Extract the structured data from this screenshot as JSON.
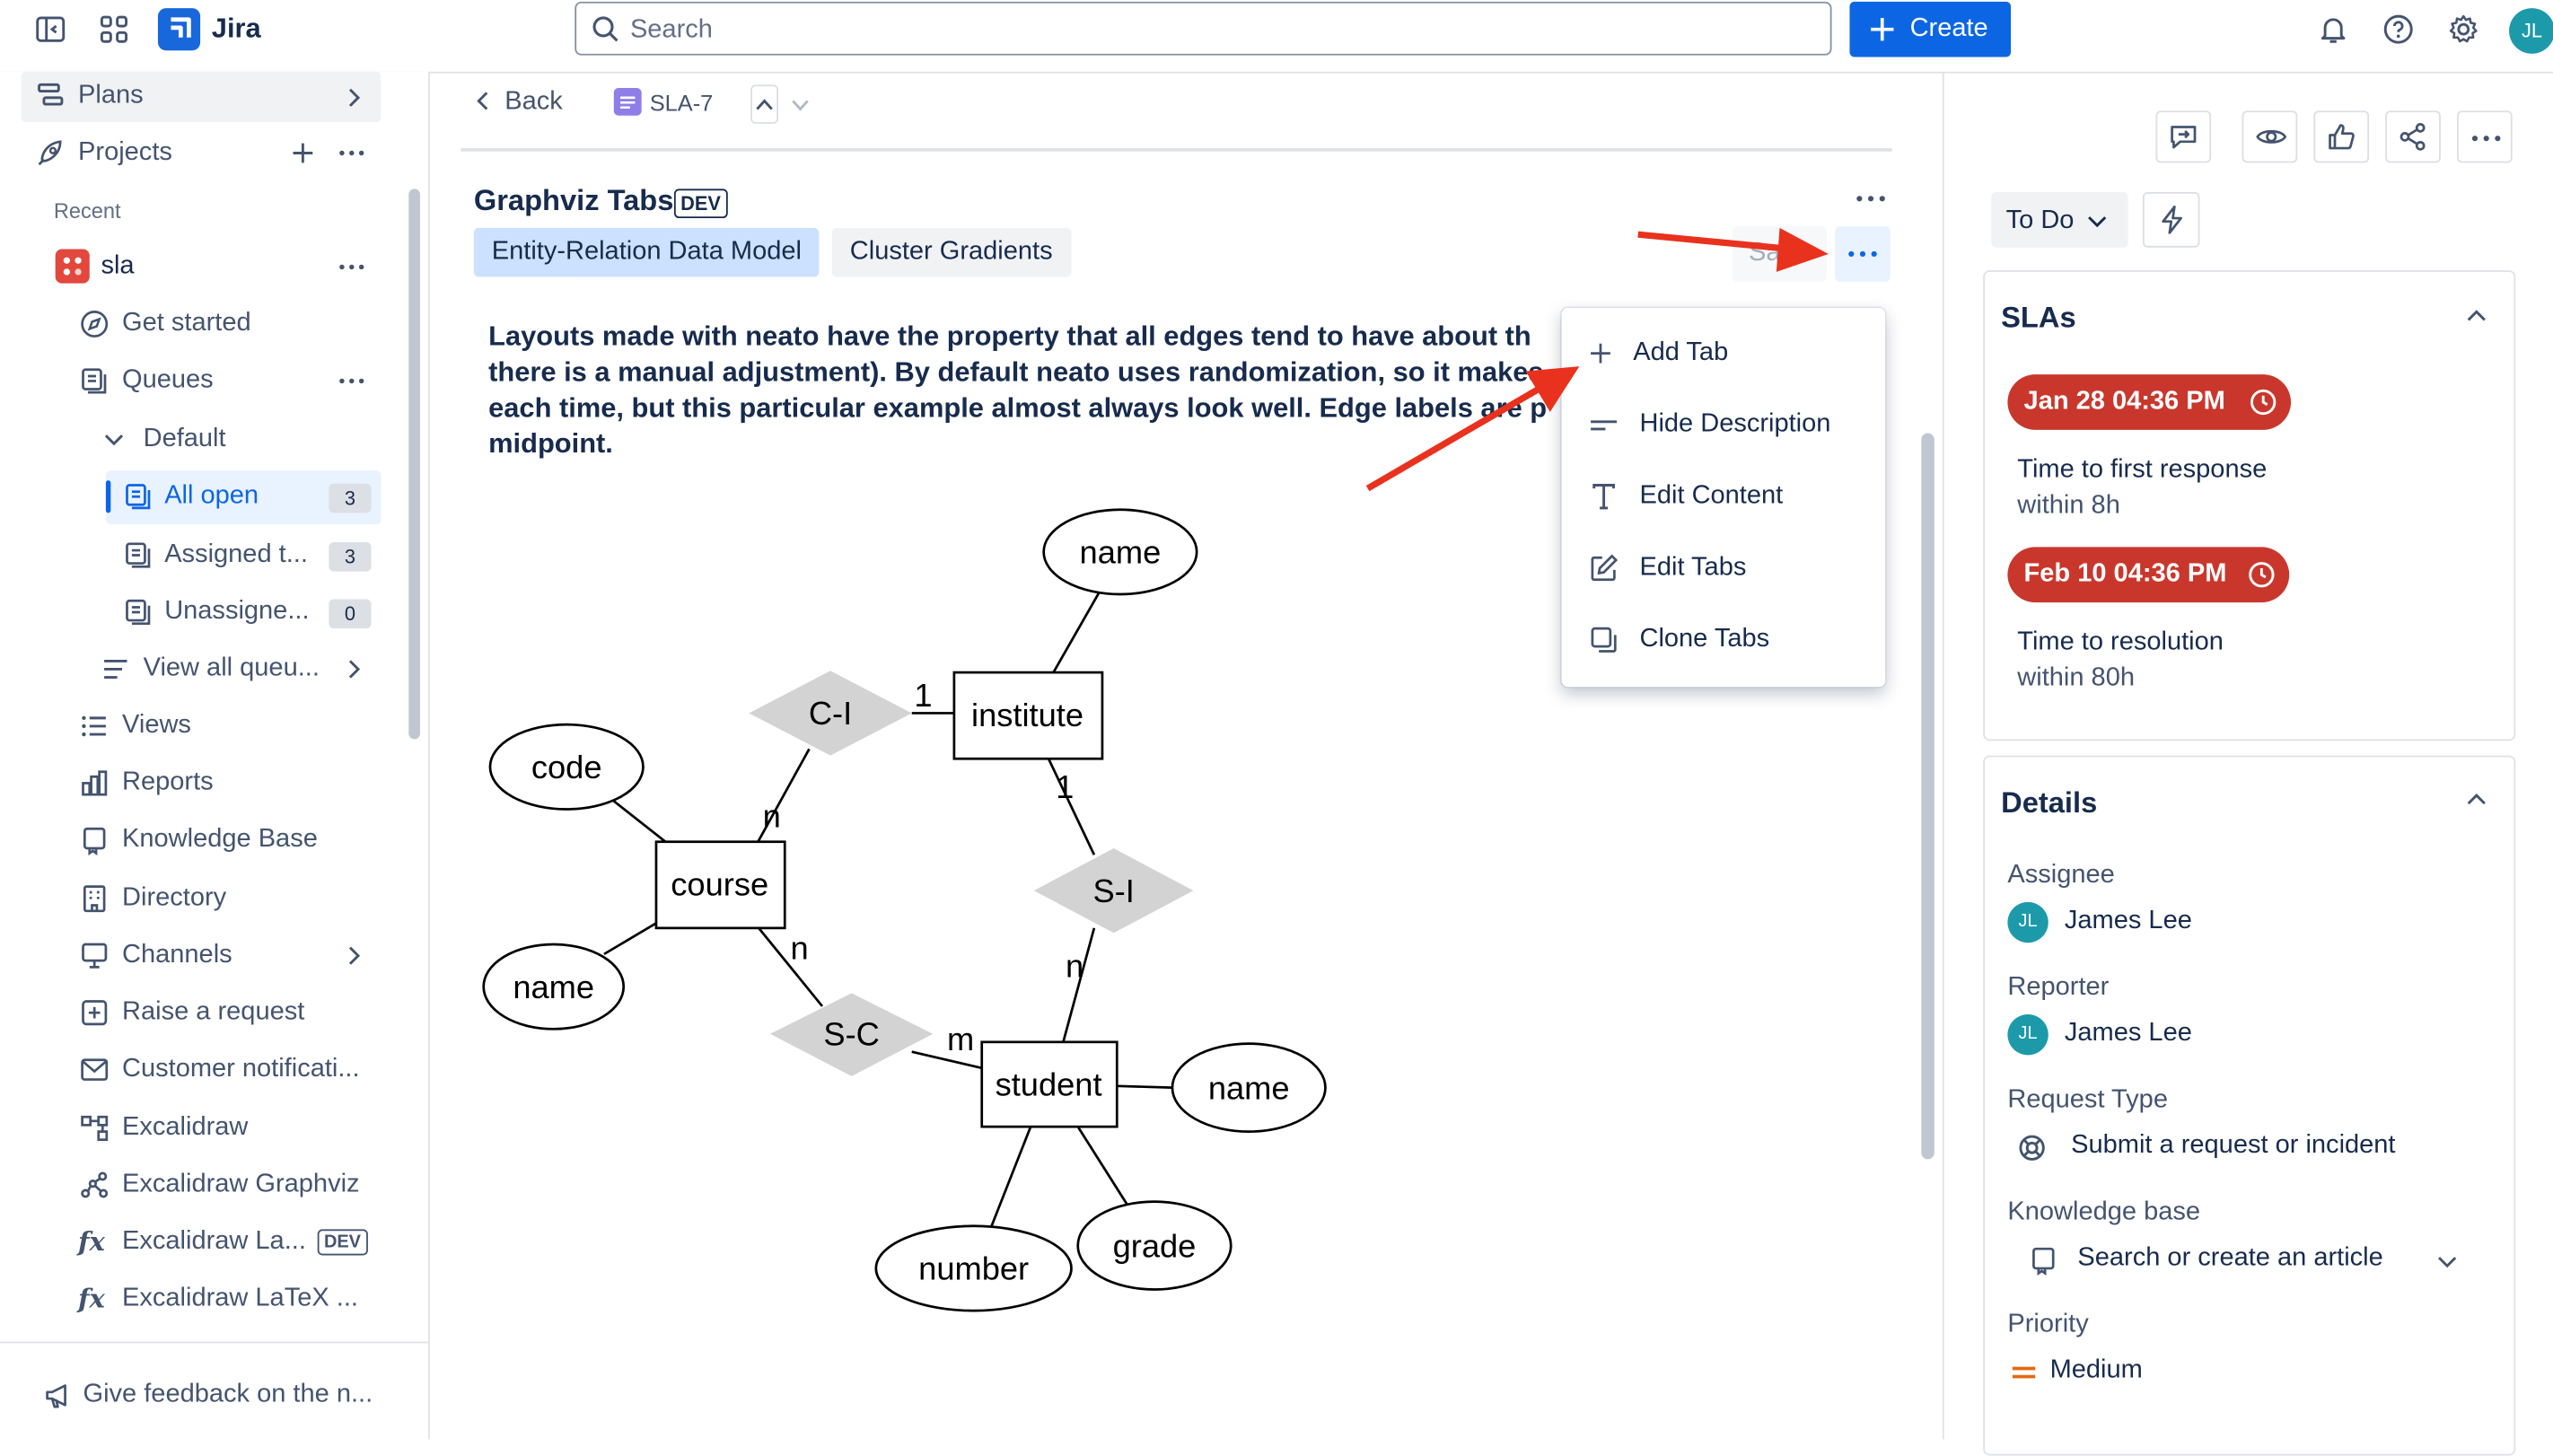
{
  "topbar": {
    "app_name": "Jira",
    "search_placeholder": "Search",
    "create_label": "Create",
    "avatar_initials": "JL"
  },
  "sidebar": {
    "plans": "Plans",
    "projects": "Projects",
    "recent": "Recent",
    "project_name": "sla",
    "items": {
      "get_started": "Get started",
      "queues": "Queues",
      "default": "Default",
      "all_open": "All open",
      "all_open_count": "3",
      "assigned": "Assigned t...",
      "assigned_count": "3",
      "unassigned": "Unassigne...",
      "unassigned_count": "0",
      "view_all_queues": "View all queu...",
      "views": "Views",
      "reports": "Reports",
      "knowledge_base": "Knowledge Base",
      "directory": "Directory",
      "channels": "Channels",
      "raise_request": "Raise a request",
      "customer_notifications": "Customer notificati...",
      "excalidraw": "Excalidraw",
      "excalidraw_graphviz": "Excalidraw Graphviz",
      "excalidraw_la": "Excalidraw La...",
      "excalidraw_la_badge": "DEV",
      "excalidraw_latex": "Excalidraw LaTeX ..."
    },
    "feedback": "Give feedback on the n..."
  },
  "main": {
    "back": "Back",
    "issue_key": "SLA-7",
    "panel_title": "Graphviz Tabs",
    "dev_badge": "DEV",
    "tabs": [
      "Entity-Relation Data Model",
      "Cluster Gradients"
    ],
    "save_partial": "Sa",
    "description": [
      "Layouts made with neato have the property that all edges tend to have about th",
      "there is a manual adjustment). By default neato uses randomization, so it makes",
      "each time, but this particular example almost always look well. Edge labels are p",
      "midpoint."
    ],
    "menu": {
      "items": [
        "Add Tab",
        "Hide Description",
        "Edit Content",
        "Edit Tabs",
        "Clone Tabs"
      ]
    },
    "graph": {
      "entities": [
        "course",
        "institute",
        "student"
      ],
      "attributes": [
        "name",
        "code",
        "name",
        "name",
        "number",
        "grade"
      ],
      "relations": [
        "C-I",
        "S-C",
        "S-I"
      ],
      "edge_labels": [
        "1",
        "n",
        "n",
        "m",
        "1",
        "n"
      ]
    }
  },
  "right": {
    "status": "To Do",
    "slas": {
      "title": "SLAs",
      "items": [
        {
          "badge": "Jan 28 04:36 PM",
          "label": "Time to first response",
          "sub": "within 8h"
        },
        {
          "badge": "Feb 10 04:36 PM",
          "label": "Time to resolution",
          "sub": "within 80h"
        }
      ]
    },
    "details": {
      "title": "Details",
      "assignee_label": "Assignee",
      "assignee": "James Lee",
      "reporter_label": "Reporter",
      "reporter": "James Lee",
      "request_type_label": "Request Type",
      "request_type": "Submit a request or incident",
      "kb_label": "Knowledge base",
      "kb_value": "Search or create an article",
      "priority_label": "Priority",
      "priority": "Medium",
      "initials": "JL"
    }
  },
  "colors": {
    "primary": "#0c66e4",
    "sla_red": "#c9372c",
    "arrow_red": "#e8321e",
    "selected_bg": "#e9f2ff",
    "tab_active_bg": "#cce0ff"
  }
}
